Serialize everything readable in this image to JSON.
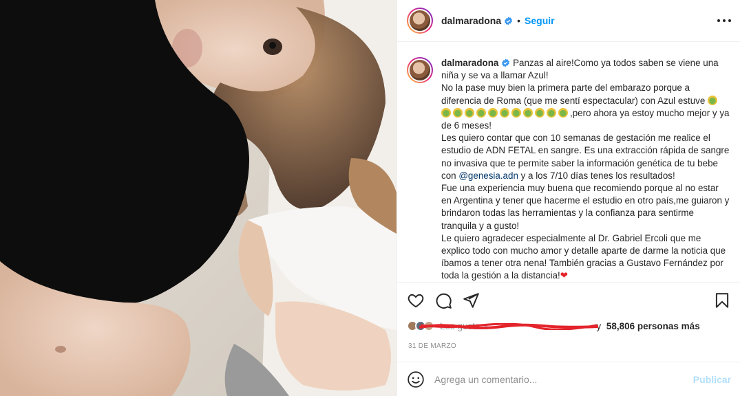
{
  "post": {
    "username": "dalmaradona",
    "follow_label": "Seguir",
    "dot": "•",
    "caption_lines": [
      "Panzas al aire!Como ya todos saben se viene una niña y se va a llamar Azul!",
      "No la pase muy bien la primera parte del embarazo porque a diferencia de Roma (que me sentí espectacular) con Azul estuve",
      ",pero ahora ya estoy mucho mejor y ya de 6 meses!",
      "Les quiero contar que con 10 semanas de gestación me realice el estudio de ADN FETAL en sangre. Es una extracción rápida de sangre no invasiva que te permite saber la información genética de tu bebe con",
      "@genesia.adn",
      "y a los 7/10 días tenes los resultados!",
      "Fue una experiencia muy buena que recomiendo porque al no estar en Argentina y tener que hacerme el estudio en otro país,me guiaron y brindaron todas las herramientas y la confianza para sentirme tranquila y a gusto!",
      "Le quiero agradecer especialmente al Dr. Gabriel Ercoli que me explico todo con mucho amor y detalle aparte de darme la noticia que íbamos a tener otra nena! También gracias a Gustavo Fernández por toda la gestión a la distancia!",
      "❤"
    ],
    "likes_prefix": "Les gusta a",
    "likes_suffix": "y",
    "likes_count": "58,806 personas más",
    "date": "31 DE MARZO",
    "comment_placeholder": "Agrega un comentario...",
    "publish_label": "Publicar"
  },
  "colors": {
    "accent": "#0095f6",
    "publish_disabled": "#b2dffc",
    "mention": "#00376b",
    "redaction": "#e3242b"
  },
  "icons": [
    "verified-icon",
    "more-options-icon",
    "heart-icon",
    "comment-icon",
    "share-icon",
    "save-icon",
    "emoji-icon",
    "sick-face-emoji",
    "red-heart-emoji"
  ]
}
